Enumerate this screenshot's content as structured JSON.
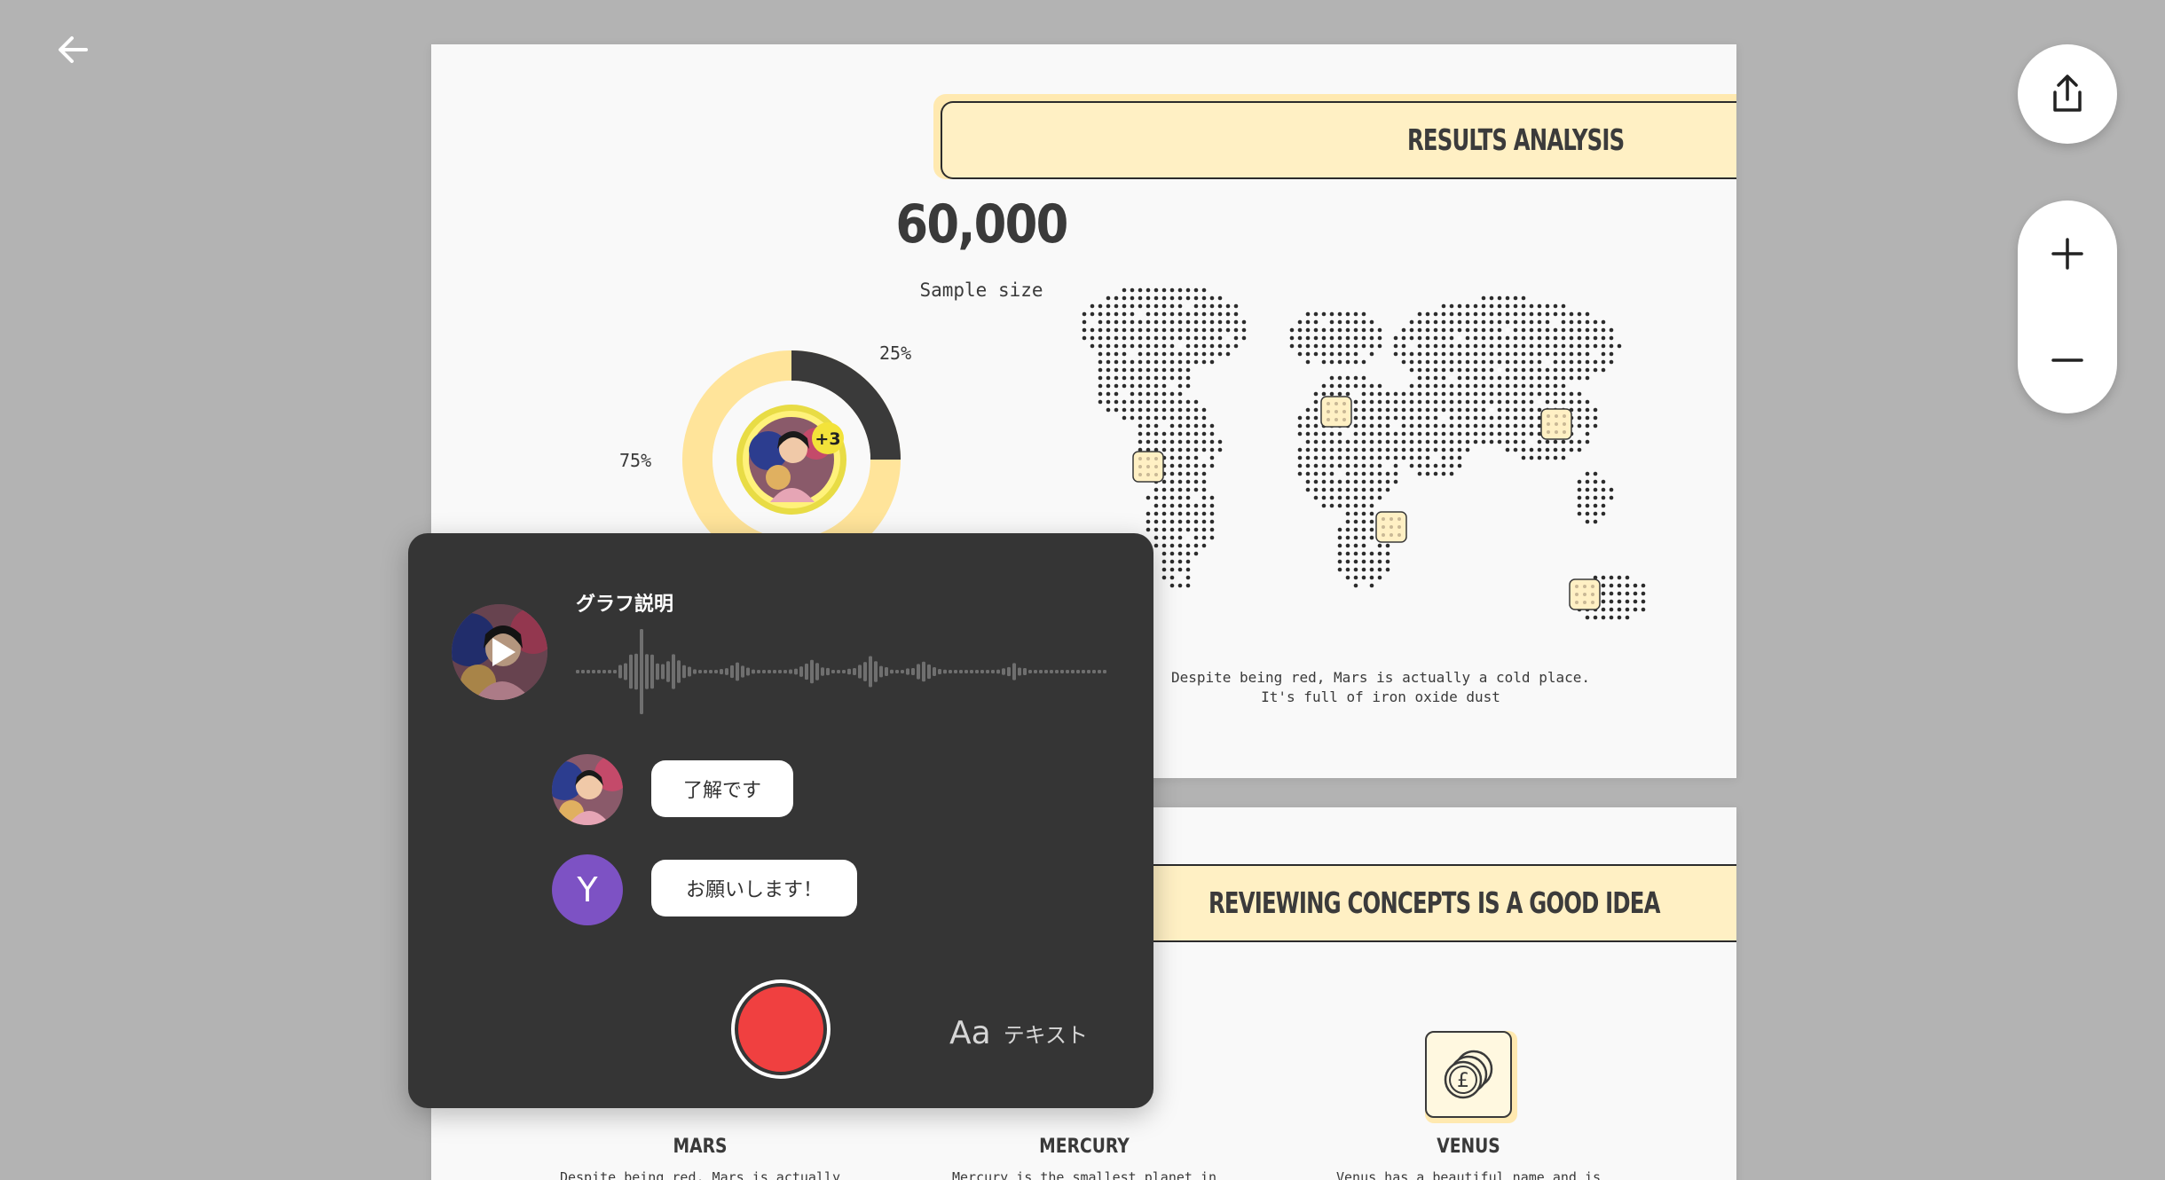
{
  "slide1": {
    "banner_title": "RESULTS ANALYSIS",
    "stat_value": "60,000",
    "stat_label": "Sample size",
    "donut": {
      "outer_label": "75%",
      "inner_label": "25%",
      "outer_value": 75,
      "inner_value": 25,
      "outer_color": "#ffe49a",
      "inner_color": "#3a3a3a"
    },
    "avatar_badge": "+3",
    "map_caption": "Despite being red, Mars is actually a cold place. It's full of iron oxide dust"
  },
  "slide2": {
    "banner_title": "REVIEWING CONCEPTS IS A GOOD IDEA",
    "planets": [
      {
        "name": "MARS",
        "desc": "Despite being red, Mars is actually a"
      },
      {
        "name": "MERCURY",
        "desc": "Mercury is the smallest planet in our"
      },
      {
        "name": "VENUS",
        "desc": "Venus has a beautiful name and is the"
      }
    ],
    "venus_icon": "coins-pound-icon"
  },
  "voice_panel": {
    "title": "グラフ説明",
    "messages": [
      {
        "sender": "photo-avatar",
        "text": "了解です"
      },
      {
        "sender": "Y",
        "text": "お願いします！"
      }
    ],
    "text_mode_icon": "Aa",
    "text_mode_label": "テキスト",
    "record_color": "#f04040"
  },
  "controls": {
    "back_icon": "arrow-left-icon",
    "share_icon": "share-icon",
    "zoom_in_icon": "plus-icon",
    "zoom_out_icon": "minus-icon"
  }
}
